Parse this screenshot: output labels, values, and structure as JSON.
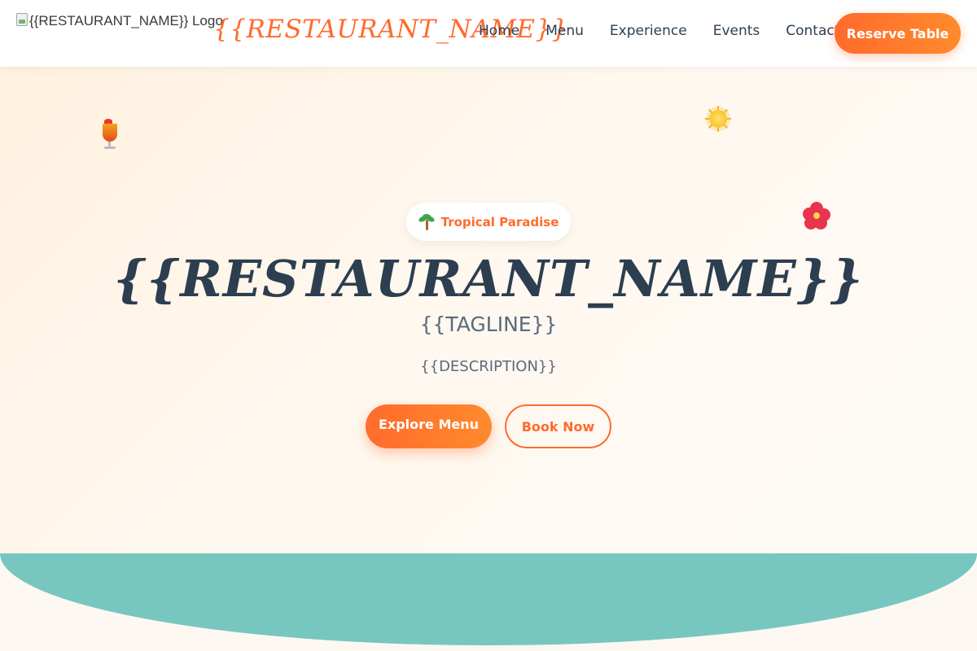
{
  "nav": {
    "logo_alt": "{{RESTAURANT_NAME}} Logo",
    "brand": "{{RESTAURANT_NAME}}",
    "links": [
      "Home",
      "Menu",
      "Experience",
      "Events",
      "Contact"
    ],
    "reserve_label": "Reserve Table"
  },
  "hero": {
    "badge_label": "Tropical Paradise",
    "badge_icon": "palm-tree-icon",
    "title": "{{RESTAURANT_NAME}}",
    "tagline": "{{TAGLINE}}",
    "description": "{{DESCRIPTION}}",
    "primary_button": "Explore Menu",
    "secondary_button": "Book Now",
    "decor_icons": [
      "tropical-drink-icon",
      "sun-icon",
      "hibiscus-icon"
    ]
  },
  "colors": {
    "accent": "#ff6b2c",
    "heading": "#2c3e50",
    "wave": "#77c7c0",
    "background": "#fdf8f2"
  }
}
